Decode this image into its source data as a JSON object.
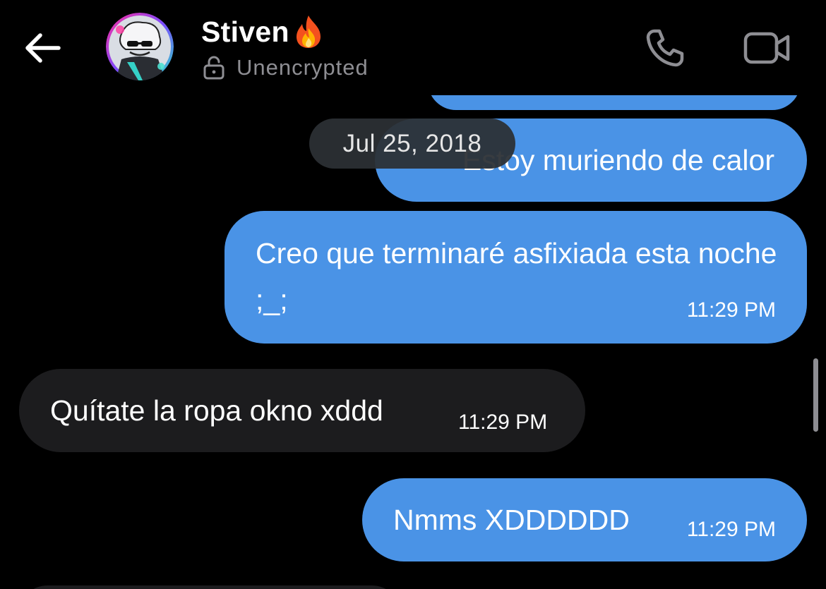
{
  "header": {
    "contact_name": "Stiven",
    "status_text": "Unencrypted",
    "icons": {
      "back": "back-arrow-icon",
      "lock": "unlocked-lock-icon",
      "call": "phone-icon",
      "video": "video-camera-icon",
      "emoji": "fire-emoji-icon"
    }
  },
  "date_separator": "Jul 25, 2018",
  "messages": [
    {
      "direction": "outgoing",
      "text": "",
      "time": ""
    },
    {
      "direction": "outgoing",
      "text": "Estoy muriendo de calor",
      "time": ""
    },
    {
      "direction": "outgoing",
      "text": "Creo que terminaré asfixiada esta noche ;_;",
      "time": "11:29 PM"
    },
    {
      "direction": "incoming",
      "text": "Quítate la ropa okno xddd",
      "time": "11:29 PM"
    },
    {
      "direction": "outgoing",
      "text": "Nmms XDDDDDD",
      "time": "11:29 PM"
    }
  ],
  "colors": {
    "background": "#000000",
    "outgoing_bubble": "#4a93e6",
    "incoming_bubble": "#1c1c1e",
    "secondary_text": "#8e8e93",
    "date_pill": "#2c3034"
  }
}
